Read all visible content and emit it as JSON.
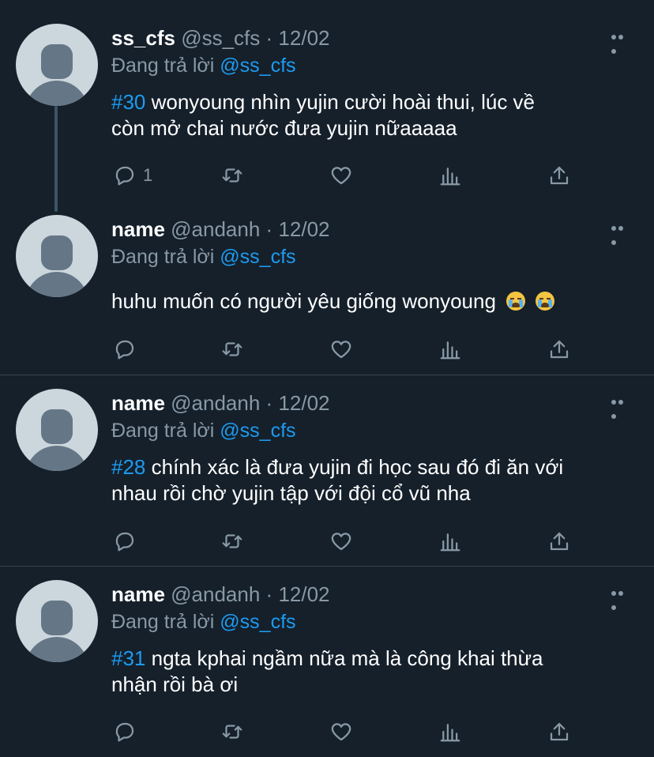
{
  "tweets": [
    {
      "name": "ss_cfs",
      "handle": "@ss_cfs",
      "sep": "·",
      "date": "12/02",
      "reply_prefix": "Đang trả lời",
      "reply_to": "@ss_cfs",
      "hashtag": "#30",
      "text_line1": " wonyoung nhìn yujin cười hoài thui, lúc về",
      "text_line2": "còn mở chai nước đưa yujin nữaaaaa",
      "reply_count": "1"
    },
    {
      "name": "name",
      "handle": "@andanh",
      "sep": "·",
      "date": "12/02",
      "reply_prefix": "Đang trả lời",
      "reply_to": "@ss_cfs",
      "text": "huhu muốn có người yêu giống wonyoung",
      "emojis": [
        "loudly-crying-face",
        "loudly-crying-face"
      ]
    },
    {
      "name": "name",
      "handle": "@andanh",
      "sep": "·",
      "date": "12/02",
      "reply_prefix": "Đang trả lời",
      "reply_to": "@ss_cfs",
      "hashtag": "#28",
      "text_line1": " chính xác là đưa yujin đi học sau đó đi ăn với",
      "text_line2": "nhau rồi chờ yujin tập với đội cổ vũ nha"
    },
    {
      "name": "name",
      "handle": "@andanh",
      "sep": "·",
      "date": "12/02",
      "reply_prefix": "Đang trả lời",
      "reply_to": "@ss_cfs",
      "hashtag": "#31",
      "text_line1": " ngta kphai ngầm nữa mà là công khai thừa",
      "text_line2": "nhận rồi bà ơi"
    }
  ],
  "icons": [
    "reply-icon",
    "retweet-icon",
    "like-icon",
    "analytics-icon",
    "share-icon",
    "more-icon"
  ],
  "colors": {
    "background": "#15202b",
    "accent": "#1d9bf0",
    "muted": "#8899a6",
    "divider": "#38444d"
  }
}
